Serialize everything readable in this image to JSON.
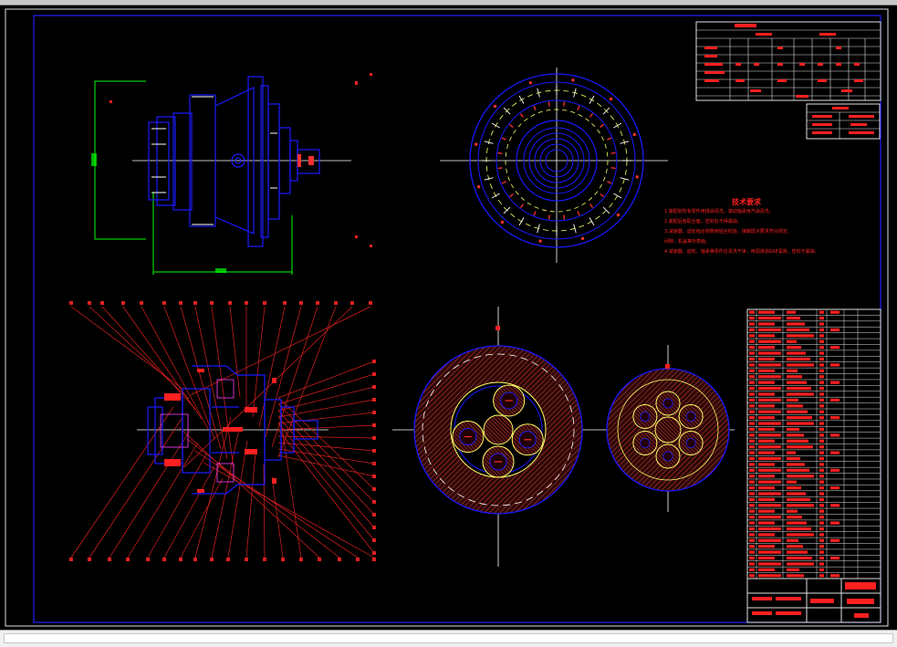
{
  "app": {
    "name": "CAD drawing viewer",
    "colors": {
      "background": "#000000",
      "frame": "#1010ff",
      "outline": "#0000ff",
      "annotation": "#ff0000",
      "centerline": "#ffffff",
      "dimension": "#00ff00",
      "pitch_circle": "#ffff00",
      "hatch": "#a52a2a",
      "detail": "#ff00ff"
    }
  },
  "drawing": {
    "views": [
      "side-view",
      "front-circular-view",
      "section-assembly-view",
      "planet-stage-1-section",
      "planet-stage-2-section"
    ],
    "technical_notes": {
      "title": "技术要求",
      "items": [
        "1.装配前所有零件用煤油清洗，滚动轴承用汽油清洗。",
        "2.装配后各配合面，密封处不得漏油。",
        "3.减速器、齿轮啮合侧隙用铅丝检验，接触斑点要求符合规定。",
        "间隙、机盖等外表面。",
        "4.减速器、齿轮、轴承等零件应清洗干净，用润滑油SAE润滑，密封不漏油。"
      ]
    }
  },
  "scrollbar": {
    "orientation": "horizontal"
  }
}
